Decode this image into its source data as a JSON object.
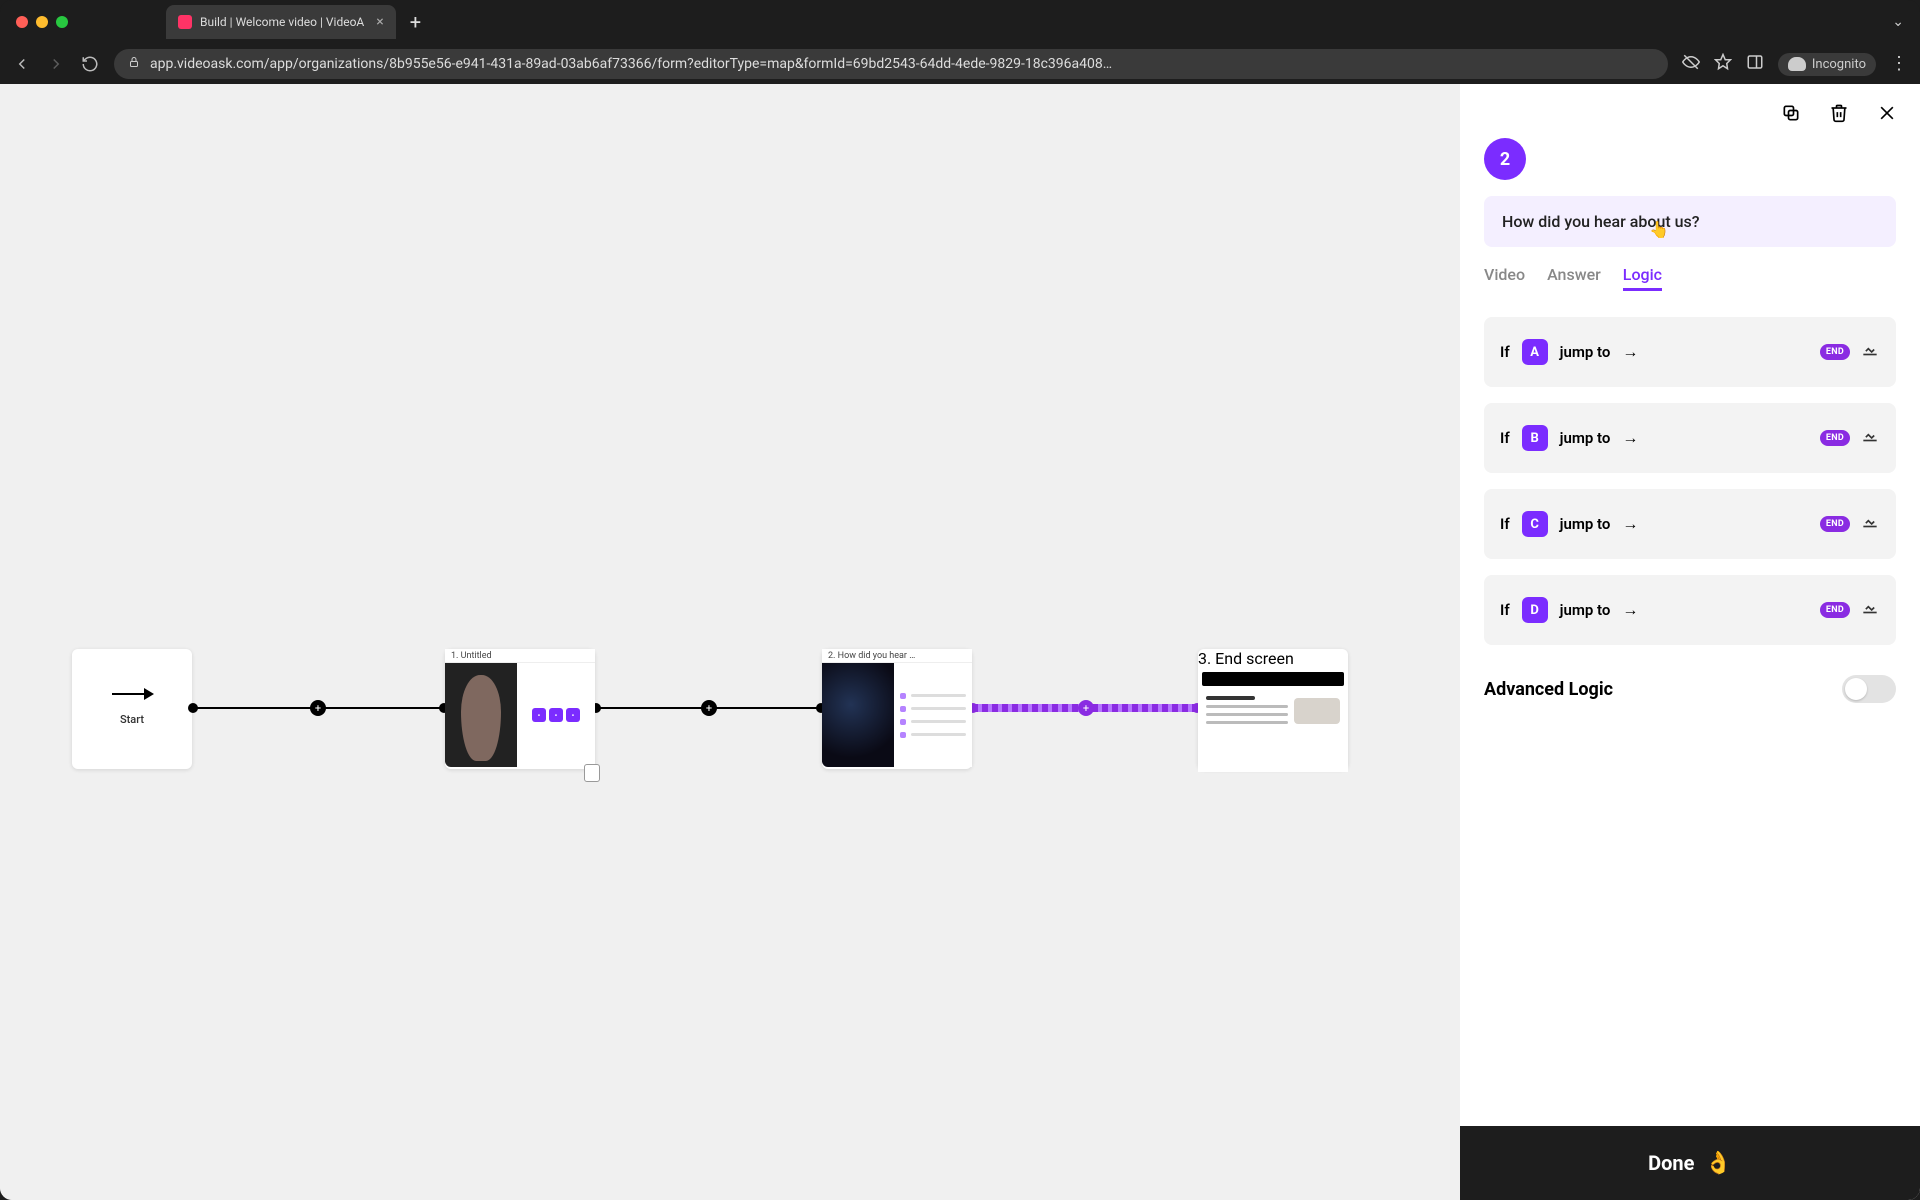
{
  "browser": {
    "tab_title": "Build | Welcome video | VideoA",
    "url": "app.videoask.com/app/organizations/8b955e56-e941-431a-89ad-03ab6af73366/form?editorType=map&formId=69bd2543-64dd-4ede-9829-18c396a408…",
    "incognito_label": "Incognito"
  },
  "canvas": {
    "start_label": "Start",
    "steps": [
      {
        "index": "1",
        "title": "1. Untitled"
      },
      {
        "index": "2",
        "title": "2. How did you hear …"
      },
      {
        "index": "3",
        "title": "3. End screen"
      }
    ]
  },
  "panel": {
    "step_number": "2",
    "question": "How did you hear about us?",
    "tabs": {
      "video": "Video",
      "answer": "Answer",
      "logic": "Logic"
    },
    "active_tab": "logic",
    "rules": [
      {
        "if": "If",
        "letter": "A",
        "jump": "jump to",
        "target_badge": "END"
      },
      {
        "if": "If",
        "letter": "B",
        "jump": "jump to",
        "target_badge": "END"
      },
      {
        "if": "If",
        "letter": "C",
        "jump": "jump to",
        "target_badge": "END"
      },
      {
        "if": "If",
        "letter": "D",
        "jump": "jump to",
        "target_badge": "END"
      }
    ],
    "advanced_label": "Advanced Logic",
    "done_label": "Done"
  }
}
